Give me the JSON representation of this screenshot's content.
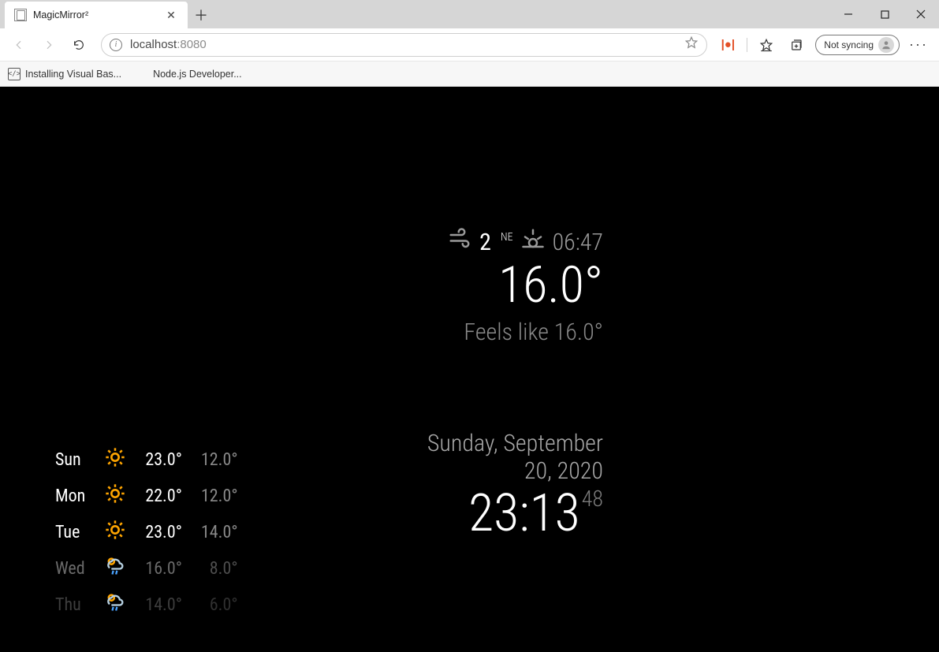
{
  "browser": {
    "tab_title": "MagicMirror²",
    "url_host": "localhost",
    "url_port": ":8080",
    "sync_label": "Not syncing",
    "bookmarks": [
      {
        "label": "Installing Visual Bas..."
      },
      {
        "label": "Node.js Developer..."
      }
    ]
  },
  "weather": {
    "wind_speed": "2",
    "wind_dir": "NE",
    "sun_time": "06:47",
    "temp": "16.0°",
    "feels_like": "Feels like 16.0°"
  },
  "clock": {
    "date": "Sunday, September 20, 2020",
    "time": "23:13",
    "seconds": "48"
  },
  "forecast": [
    {
      "day": "Sun",
      "icon": "sun",
      "hi": "23.0°",
      "lo": "12.0°",
      "fade": ""
    },
    {
      "day": "Mon",
      "icon": "sun",
      "hi": "22.0°",
      "lo": "12.0°",
      "fade": ""
    },
    {
      "day": "Tue",
      "icon": "sun",
      "hi": "23.0°",
      "lo": "14.0°",
      "fade": ""
    },
    {
      "day": "Wed",
      "icon": "cloud-rain",
      "hi": "16.0°",
      "lo": "8.0°",
      "fade": "fade1"
    },
    {
      "day": "Thu",
      "icon": "cloud-rain",
      "hi": "14.0°",
      "lo": "6.0°",
      "fade": "fade2"
    }
  ]
}
